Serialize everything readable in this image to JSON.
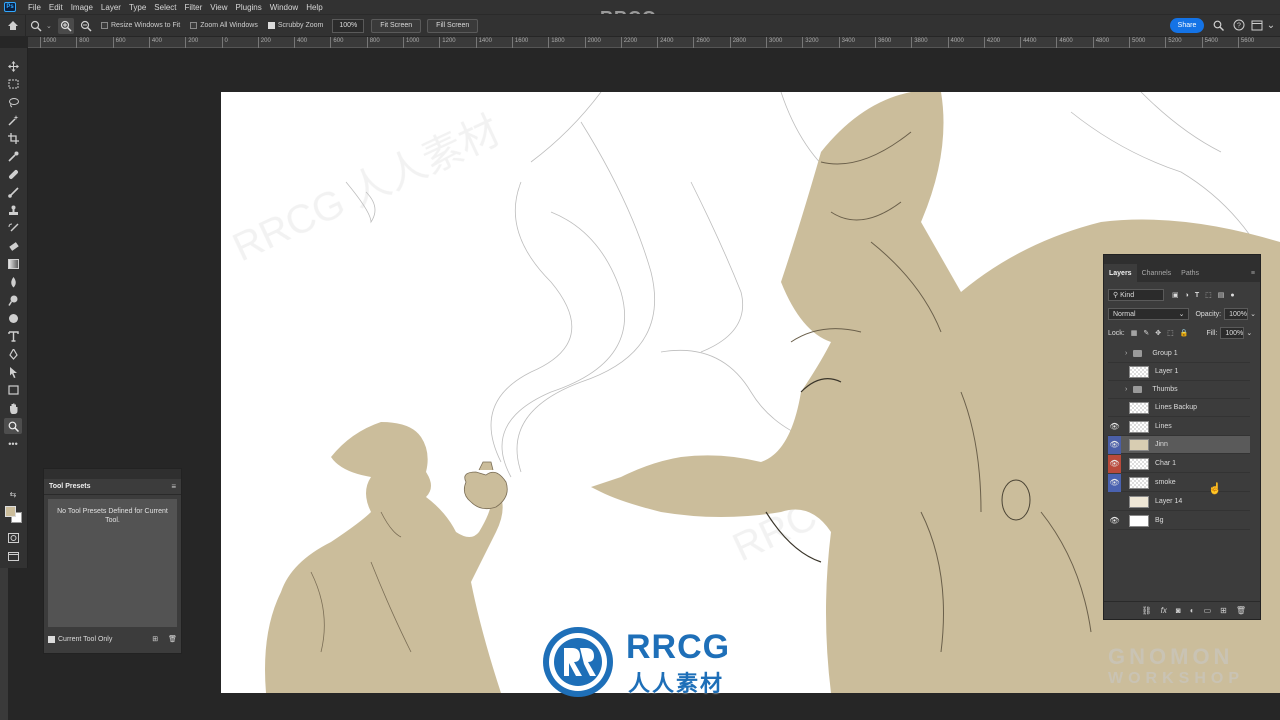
{
  "app": {
    "logo": "Ps",
    "watermark_top": "RRCG.cn"
  },
  "menu": [
    "File",
    "Edit",
    "Image",
    "Layer",
    "Type",
    "Select",
    "Filter",
    "View",
    "Plugins",
    "Window",
    "Help"
  ],
  "options": {
    "resize_windows": "Resize Windows to Fit",
    "zoom_all": "Zoom All Windows",
    "scrubby_zoom": "Scrubby Zoom",
    "zoom_value": "100%",
    "fit_screen": "Fit Screen",
    "fill_screen": "Fill Screen",
    "share": "Share"
  },
  "ruler_ticks": [
    "1000",
    "800",
    "600",
    "400",
    "200",
    "0",
    "200",
    "400",
    "600",
    "800",
    "1000",
    "1200",
    "1400",
    "1600",
    "1800",
    "2000",
    "2200",
    "2400",
    "2600",
    "2800",
    "3000",
    "3200",
    "3400",
    "3600",
    "3800",
    "4000",
    "4200",
    "4400",
    "4600",
    "4800",
    "5000",
    "5200",
    "5400",
    "5600"
  ],
  "tool_presets": {
    "title": "Tool Presets",
    "empty_message": "No Tool Presets Defined for Current Tool.",
    "current_tool_only": "Current Tool Only"
  },
  "layers_panel": {
    "tabs": [
      "Layers",
      "Channels",
      "Paths"
    ],
    "filter_kind": "Kind",
    "blend_mode": "Normal",
    "opacity_label": "Opacity:",
    "opacity_value": "100%",
    "lock_label": "Lock:",
    "fill_label": "Fill:",
    "fill_value": "100%",
    "layers": [
      {
        "name": "Group 1",
        "type": "group",
        "visible": false
      },
      {
        "name": "Layer 1",
        "type": "layer",
        "visible": false
      },
      {
        "name": "Thumbs",
        "type": "group",
        "visible": false
      },
      {
        "name": "Lines Backup",
        "type": "layer",
        "visible": false
      },
      {
        "name": "Lines",
        "type": "layer",
        "visible": true
      },
      {
        "name": "Jinn",
        "type": "layer",
        "visible": true,
        "selected": true
      },
      {
        "name": "Char 1",
        "type": "layer",
        "visible": true
      },
      {
        "name": "smoke",
        "type": "layer",
        "visible": true
      },
      {
        "name": "Layer 14",
        "type": "layer",
        "visible": false
      },
      {
        "name": "Bg",
        "type": "layer",
        "visible": true
      }
    ]
  },
  "brand": {
    "rrcg": "RRCG",
    "rrcg_cn": "人人素材",
    "gnomon_1": "GNOMON",
    "gnomon_2": "WORKSHOP"
  },
  "colors": {
    "foreground": "#cbbd9b",
    "background": "#ffffff",
    "figure_fill": "#cbbd9b",
    "accent": "#1473e6"
  }
}
